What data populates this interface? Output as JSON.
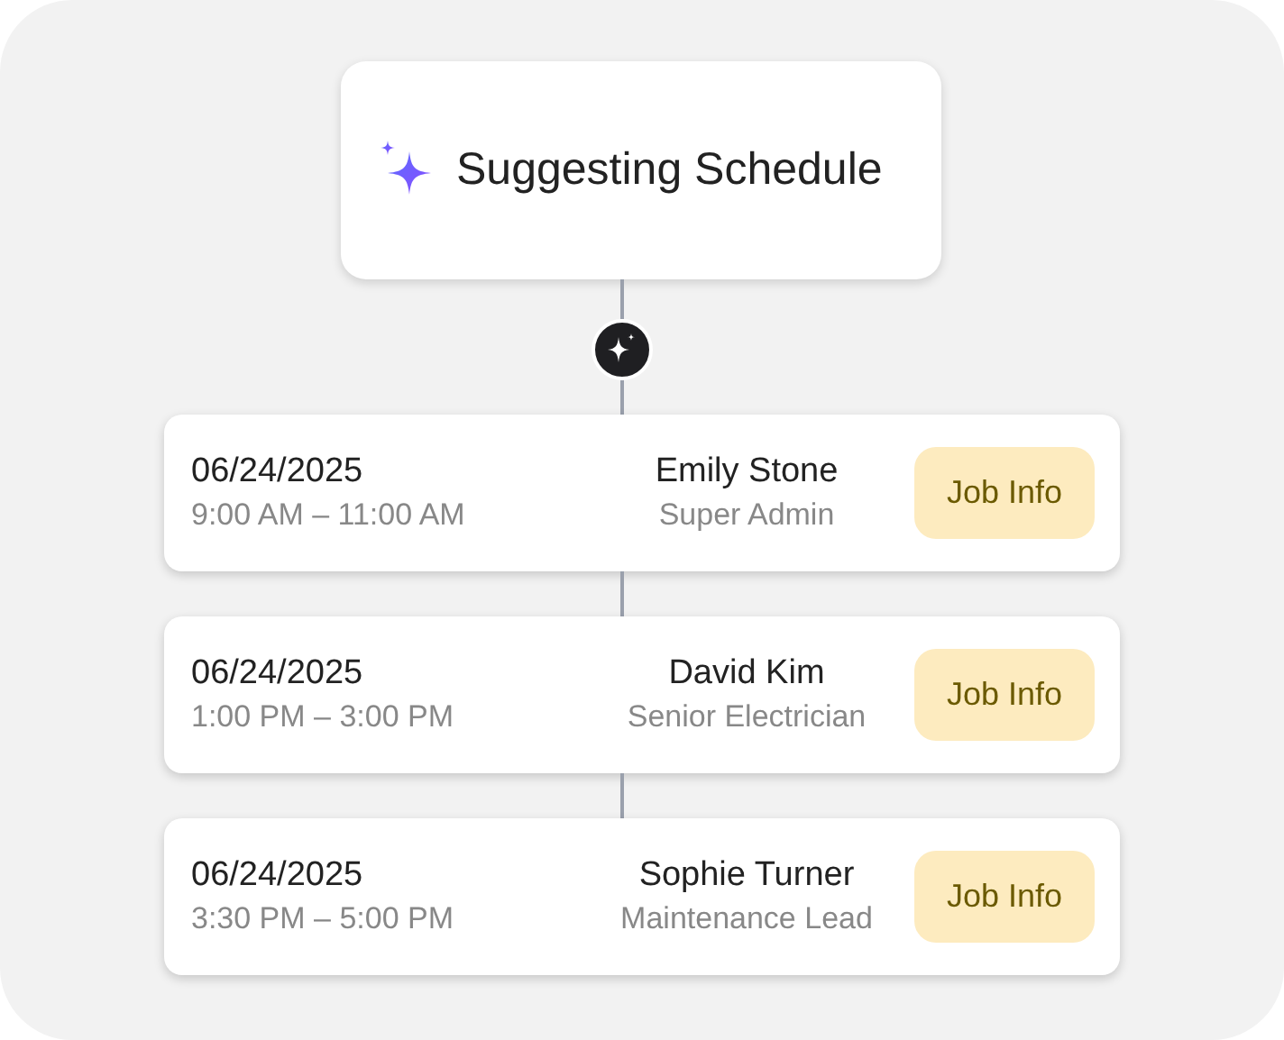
{
  "header": {
    "title": "Suggesting Schedule"
  },
  "appointments": [
    {
      "date": "06/24/2025",
      "time": "9:00 AM – 11:00 AM",
      "name": "Emily Stone",
      "role": "Super Admin",
      "action": "Job Info"
    },
    {
      "date": "06/24/2025",
      "time": "1:00 PM – 3:00 PM",
      "name": "David Kim",
      "role": "Senior Electrician",
      "action": "Job Info"
    },
    {
      "date": "06/24/2025",
      "time": "3:30 PM – 5:00 PM",
      "name": "Sophie Turner",
      "role": "Maintenance Lead",
      "action": "Job Info"
    }
  ]
}
